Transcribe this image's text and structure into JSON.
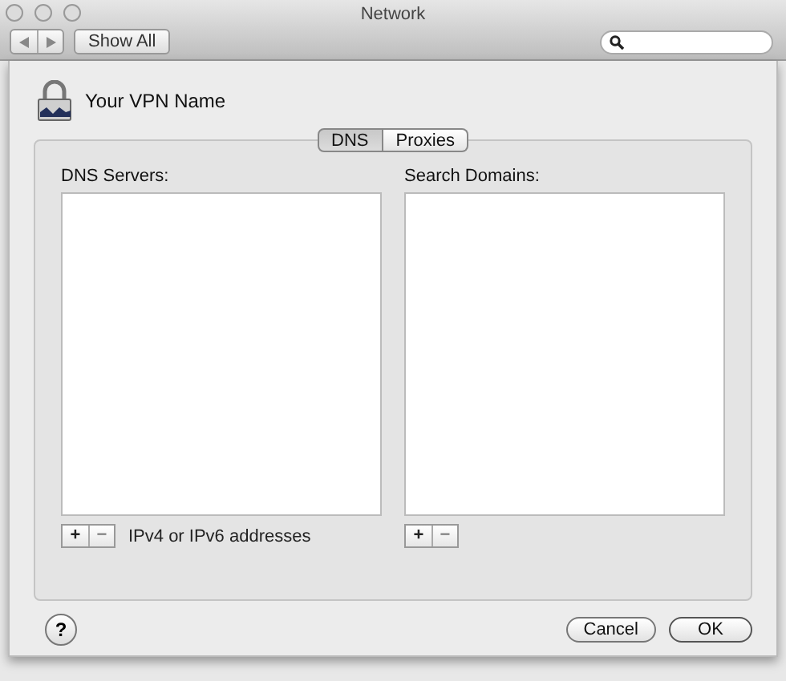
{
  "window": {
    "title": "Network"
  },
  "toolbar": {
    "show_all": "Show All"
  },
  "sheet": {
    "vpn_name": "Your VPN Name",
    "tabs": [
      {
        "label": "DNS",
        "selected": true
      },
      {
        "label": "Proxies",
        "selected": false
      }
    ],
    "dns_servers": {
      "label": "DNS Servers:",
      "add": "+",
      "remove": "−",
      "hint": "IPv4 or IPv6 addresses"
    },
    "search_domains": {
      "label": "Search Domains:",
      "add": "+",
      "remove": "−"
    },
    "help": "?",
    "buttons": [
      {
        "label": "Cancel",
        "kind": "cancel"
      },
      {
        "label": "OK",
        "kind": "default"
      }
    ]
  }
}
